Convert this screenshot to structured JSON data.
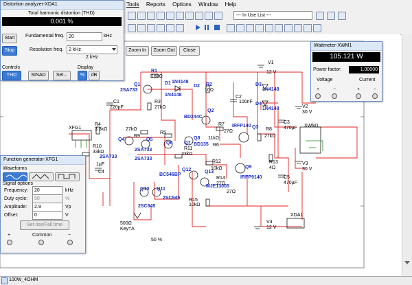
{
  "menu": [
    "Tools",
    "Reports",
    "Options",
    "Window",
    "Help"
  ],
  "toolbar": {
    "in_use_list": "--- In Use List ---"
  },
  "zoom_buttons": [
    "Zoom In",
    "Zoom Out",
    "Close"
  ],
  "distortion": {
    "title": "Distortion analyzer-XDA1",
    "thd_label": "Total harmonic distortion (THD)",
    "thd_value": "0.001 %",
    "start": "Start",
    "stop": "Stop",
    "fund_label": "Fundamental freq.",
    "fund_value": "20",
    "fund_unit": "kHz",
    "res_label": "Resolution freq.",
    "res_value": "2 kHz",
    "res_sub": "2 kHz",
    "controls_label": "Controls",
    "display_label": "Display",
    "thd_btn": "THD",
    "sinad_btn": "SINAD",
    "set_btn": "Set...",
    "pct_btn": "%",
    "db_btn": "dB"
  },
  "wattmeter": {
    "title": "Wattmeter-XWM1",
    "power": "105.121 W",
    "pf_label": "Power factor:",
    "pf_value": "1.00000",
    "voltage": "Voltage",
    "current": "Current"
  },
  "funcgen": {
    "title": "Function generator-XFG1",
    "waveforms": "Waveforms",
    "signal_options": "Signal options",
    "freq_label": "Frequency:",
    "freq_value": "20",
    "freq_unit": "kHz",
    "duty_label": "Duty cycle:",
    "duty_value": "50",
    "duty_unit": "%",
    "amp_label": "Amplitude:",
    "amp_value": "2.9",
    "amp_unit": "Vp",
    "off_label": "Offset:",
    "off_value": "0",
    "off_unit": "V",
    "rise_btn": "Set rise/Fall time",
    "common": "Common"
  },
  "schematic": {
    "labels_blue": [
      "R1",
      "180Ω",
      "D1",
      "1N4148",
      "D2",
      "1N4148",
      "R2",
      "10Ω",
      "Q1",
      "2SA733",
      "C1",
      "220pF",
      "R3",
      "27kΩ",
      "BD244C",
      "Q2",
      "C2",
      "100nF",
      "D3",
      "1N4148",
      "D4",
      "1N4148",
      "V1",
      "12 V",
      "V2",
      "30 V",
      "R4",
      "3.3kΩ",
      "R9",
      "27kΩ",
      "R6",
      "R5",
      "R7",
      "27Ω",
      "11kΩ",
      "IRFP140",
      "Q3",
      "R8",
      "27kΩ",
      "C3",
      "470µF",
      "XWM1",
      "XFG1",
      "Q4",
      "Q5",
      "Q6",
      "Q7",
      "Q8",
      "BD135",
      "R10",
      "33kΩ",
      "2SA733",
      "2SA733",
      "2SA733",
      "R11",
      "33kΩ",
      "C4",
      "1µF",
      "BC546BP",
      "Q12",
      "R12",
      "10kΩ",
      "Q13",
      "MJE13005",
      "Q9",
      "IRFP9140",
      "R13",
      "4Ω",
      "V3",
      "30 V",
      "C5",
      "470µF",
      "Q10",
      "Q11",
      "2SC945",
      "2SC945",
      "R15",
      "10kΩ",
      "V4",
      "12 V",
      "XDA1",
      "500Ω",
      "Key=A",
      "50 %",
      "27Ω",
      "R14",
      "27Ω"
    ]
  },
  "status": {
    "tab": "100W_4OHM"
  }
}
